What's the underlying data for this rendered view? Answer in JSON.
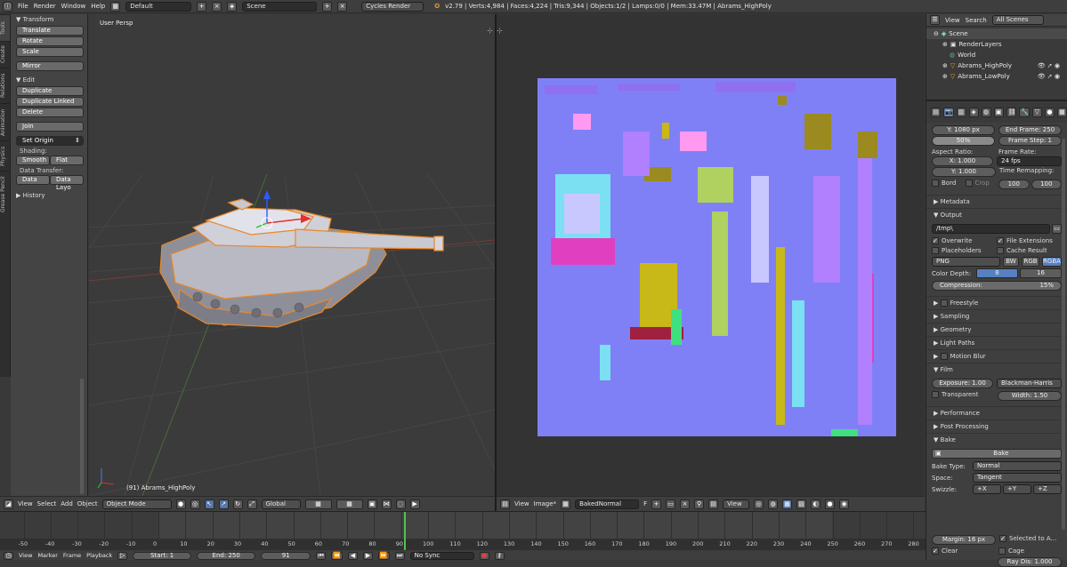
{
  "topbar": {
    "menus": [
      "File",
      "Render",
      "Window",
      "Help"
    ],
    "screen_layout": "Default",
    "scene": "Scene",
    "render_engine": "Cycles Render",
    "stats": "v2.79 | Verts:4,984 | Faces:4,224 | Tris:9,344 | Objects:1/2 | Lamps:0/0 | Mem:33.47M | Abrams_HighPoly"
  },
  "left_tabs": [
    "Tools",
    "Create",
    "Relations",
    "Animation",
    "Physics",
    "Grease Pencil"
  ],
  "tool_panel": {
    "transform": {
      "title": "Transform",
      "buttons": [
        "Translate",
        "Rotate",
        "Scale",
        "Mirror"
      ]
    },
    "edit": {
      "title": "Edit",
      "buttons": [
        "Duplicate",
        "Duplicate Linked",
        "Delete",
        "Join"
      ],
      "set_origin": "Set Origin",
      "shading_label": "Shading:",
      "smooth": "Smooth",
      "flat": "Flat",
      "data_transfer_label": "Data Transfer:",
      "data": "Data",
      "data_layout": "Data Layo"
    },
    "history": "History"
  },
  "viewport3d": {
    "view_label": "User Persp",
    "object_label": "(91) Abrams_HighPoly",
    "header": {
      "menus": [
        "View",
        "Select",
        "Add",
        "Object"
      ],
      "mode": "Object Mode",
      "orientation": "Global"
    }
  },
  "image_editor": {
    "header": {
      "menus": [
        "View",
        "Image*"
      ],
      "image_name": "BakedNormal",
      "f_label": "F",
      "view_label": "View"
    }
  },
  "outliner": {
    "tabs": [
      "View",
      "Search",
      "All Scenes"
    ],
    "items": [
      "Scene",
      "RenderLayers",
      "World",
      "Abrams_HighPoly",
      "Abrams_LowPoly"
    ]
  },
  "properties": {
    "res_y": "Y:",
    "res_y_val": "1080 px",
    "percent": "50%",
    "end_frame": "End Frame:",
    "end_frame_val": "250",
    "frame_step": "Frame Step:",
    "frame_step_val": "1",
    "aspect_label": "Aspect Ratio:",
    "frame_rate_label": "Frame Rate:",
    "asp_x": "X:",
    "asp_x_val": "1.000",
    "asp_y": "Y:",
    "asp_y_val": "1.000",
    "fps": "24 fps",
    "time_remap": "Time Remapping:",
    "bord": "Bord",
    "crop": "Crop",
    "old": "100",
    "new": "100",
    "metadata": "Metadata",
    "output": "Output",
    "output_path": "/tmp\\",
    "overwrite": "Overwrite",
    "file_ext": "File Extensions",
    "placeholders": "Placeholders",
    "cache": "Cache Result",
    "format": "PNG",
    "bw": "BW",
    "rgb": "RGB",
    "rgba": "RGBA",
    "color_depth": "Color Depth:",
    "depth8": "8",
    "depth16": "16",
    "compression": "Compression:",
    "compression_val": "15%",
    "freestyle": "Freestyle",
    "sampling": "Sampling",
    "geometry": "Geometry",
    "light_paths": "Light Paths",
    "motion_blur": "Motion Blur",
    "film": "Film",
    "exposure": "Exposure:",
    "exposure_val": "1.00",
    "filter": "Blackman-Harris",
    "transparent": "Transparent",
    "width": "Width:",
    "width_val": "1.50",
    "performance": "Performance",
    "post_processing": "Post Processing",
    "bake": "Bake",
    "bake_button": "Bake",
    "bake_type_label": "Bake Type:",
    "bake_type": "Normal",
    "space_label": "Space:",
    "space": "Tangent",
    "swizzle_label": "Swizzle:",
    "swz_x": "+X",
    "swz_y": "+Y",
    "swz_z": "+Z",
    "margin": "Margin:",
    "margin_val": "16 px",
    "selected_to_active": "Selected to A...",
    "clear": "Clear",
    "cage": "Cage",
    "ray_dist": "Ray Dis:",
    "ray_dist_val": "1.000"
  },
  "timeline": {
    "ticks": [
      "-50",
      "-40",
      "-30",
      "-20",
      "-10",
      "0",
      "10",
      "20",
      "30",
      "40",
      "50",
      "60",
      "70",
      "80",
      "90",
      "100",
      "110",
      "120",
      "130",
      "140",
      "150",
      "160",
      "170",
      "180",
      "190",
      "200",
      "210",
      "220",
      "230",
      "240",
      "250",
      "260",
      "270",
      "280"
    ],
    "current_frame": 91,
    "menus": [
      "View",
      "Marker",
      "Frame",
      "Playback"
    ],
    "start_label": "Start:",
    "start_val": "1",
    "end_label": "End:",
    "end_val": "250",
    "frame_val": "91",
    "sync": "No Sync"
  }
}
